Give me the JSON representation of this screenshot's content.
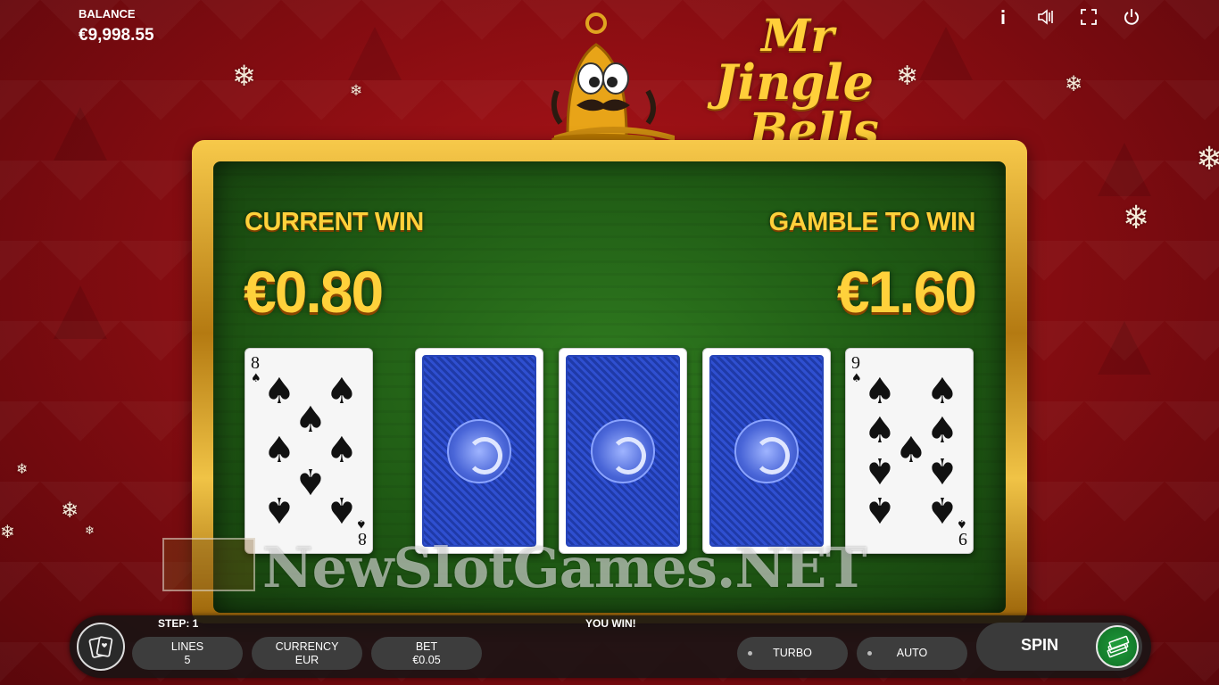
{
  "balance": {
    "label": "BALANCE",
    "value": "€9,998.55"
  },
  "top_icons": [
    "info-icon",
    "sound-icon",
    "fullscreen-icon",
    "power-icon"
  ],
  "logo": {
    "line1": "Mr",
    "line2": "Jingle",
    "line3": "Bells"
  },
  "gamble": {
    "current_win_label": "CURRENT WIN",
    "current_win_value": "€0.80",
    "gamble_to_win_label": "GAMBLE TO WIN",
    "gamble_to_win_value": "€1.60"
  },
  "cards": [
    {
      "state": "face-up",
      "rank": "8",
      "suit": "spades"
    },
    {
      "state": "face-down"
    },
    {
      "state": "face-down"
    },
    {
      "state": "face-down"
    },
    {
      "state": "face-up",
      "rank": "9",
      "suit": "spades"
    }
  ],
  "watermark": "NewSlotGames.NET",
  "bottom": {
    "step_label": "STEP: 1",
    "status": "YOU WIN!",
    "lines_label": "LINES",
    "lines_value": "5",
    "currency_label": "CURRENCY",
    "currency_value": "EUR",
    "bet_label": "BET",
    "bet_value": "€0.05",
    "turbo_label": "TURBO",
    "auto_label": "AUTO",
    "spin_label": "SPIN"
  },
  "colors": {
    "background": "#8a0d12",
    "felt": "#1f5a14",
    "gold_text": "#ffd13b",
    "frame_gold": "#d9a12a",
    "card_back": "#2744be",
    "spin_green": "#1f9a3a"
  }
}
